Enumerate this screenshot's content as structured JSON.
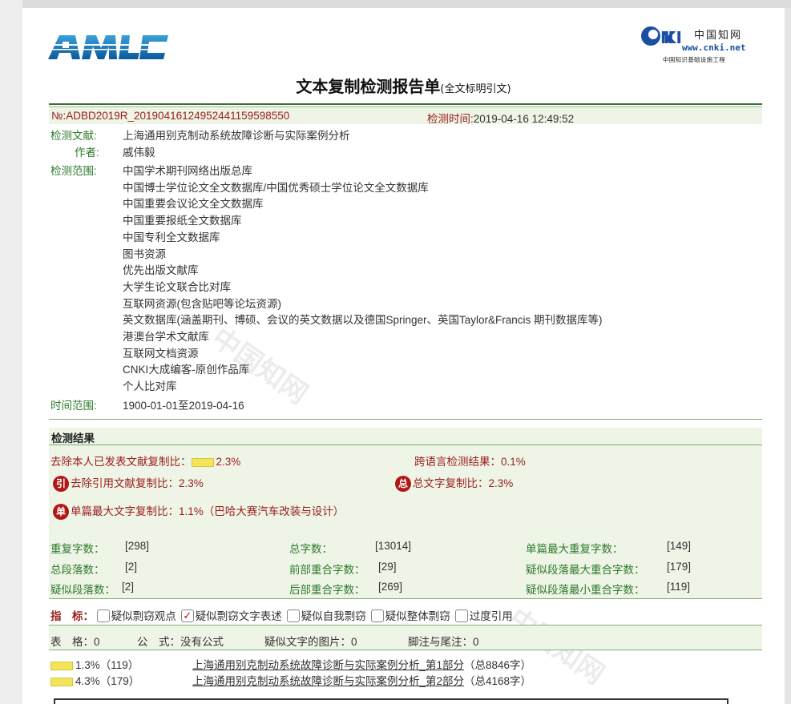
{
  "logo": {
    "cnki_name": "中国知网",
    "cnki_url": "www.cnki.net",
    "cnki_sub": "中国知识基础设施工程"
  },
  "title": {
    "main": "文本复制检测报告单",
    "suffix": "(全文标明引文)"
  },
  "report": {
    "number": "№:ADBD2019R_20190416124952441159598550",
    "time_label": "检测时间:",
    "time_value": "2019-04-16 12:49:52",
    "doc_label": "检测文献:",
    "doc_value": "上海通用别克制动系统故障诊断与实际案例分析",
    "author_label": "作者:",
    "author_value": "戚伟毅",
    "scope_label": "检测范围:",
    "scope_items": [
      "中国学术期刊网络出版总库",
      "中国博士学位论文全文数据库/中国优秀硕士学位论文全文数据库",
      "中国重要会议论文全文数据库",
      "中国重要报纸全文数据库",
      "中国专利全文数据库",
      "图书资源",
      "优先出版文献库",
      "大学生论文联合比对库",
      "互联网资源(包含贴吧等论坛资源)",
      "英文数据库(涵盖期刊、博硕、会议的英文数据以及德国Springer、英国Taylor&Francis 期刊数据库等)",
      "港澳台学术文献库",
      "互联网文档资源",
      "CNKI大成编客-原创作品库",
      "个人比对库"
    ],
    "range_label": "时间范围:",
    "range_value": "1900-01-01至2019-04-16"
  },
  "results": {
    "section_title": "检测结果",
    "self_excluded_label": "去除本人已发表文献复制比：",
    "self_excluded_value": "2.3%",
    "cross_lang_label": "跨语言检测结果：",
    "cross_lang_value": "0.1%",
    "cite_badge": "引",
    "cite_excluded_label": "去除引用文献复制比：",
    "cite_excluded_value": "2.3%",
    "total_badge": "总",
    "total_label": "总文字复制比：",
    "total_value": "2.3%",
    "single_badge": "单",
    "single_label": "单篇最大文字复制比：",
    "single_value": "1.1%（巴哈大赛汽车改装与设计）",
    "stats": {
      "dup_chars_label": "重复字数：",
      "dup_chars_value": "[298]",
      "total_chars_label": "总字数：",
      "total_chars_value": "[13014]",
      "single_max_dup_label": "单篇最大重复字数：",
      "single_max_dup_value": "[149]",
      "total_paras_label": "总段落数：",
      "total_paras_value": "[2]",
      "front_overlap_label": "前部重合字数：",
      "front_overlap_value": "[29]",
      "para_max_overlap_label": "疑似段落最大重合字数：",
      "para_max_overlap_value": "[179]",
      "susp_paras_label": "疑似段落数：",
      "susp_paras_value": "[2]",
      "back_overlap_label": "后部重合字数：",
      "back_overlap_value": "[269]",
      "para_min_overlap_label": "疑似段落最小重合字数：",
      "para_min_overlap_value": "[119]"
    },
    "indicators_label": "指　标：",
    "indicators": [
      {
        "label": "疑似剽窃观点",
        "checked": false
      },
      {
        "label": "疑似剽窃文字表述",
        "checked": true
      },
      {
        "label": "疑似自我剽窃",
        "checked": false
      },
      {
        "label": "疑似整体剽窃",
        "checked": false
      },
      {
        "label": "过度引用",
        "checked": false
      }
    ],
    "misc": {
      "table_label": "表　格：0",
      "formula_label": "公　式：没有公式",
      "img_label": "疑似文字的图片：0",
      "footnote_label": "脚注与尾注：0"
    },
    "parts": [
      {
        "ratio": "1.3%（119）",
        "title": "上海通用别克制动系统故障诊断与实际案例分析_第1部分",
        "total": "（总8846字）",
        "fill": 0.013
      },
      {
        "ratio": "4.3%（179）",
        "title": "上海通用别克制动系统故障诊断与实际案例分析_第2部分",
        "total": "（总4168字）",
        "fill": 0.043
      }
    ],
    "watermark": "中国知网"
  }
}
